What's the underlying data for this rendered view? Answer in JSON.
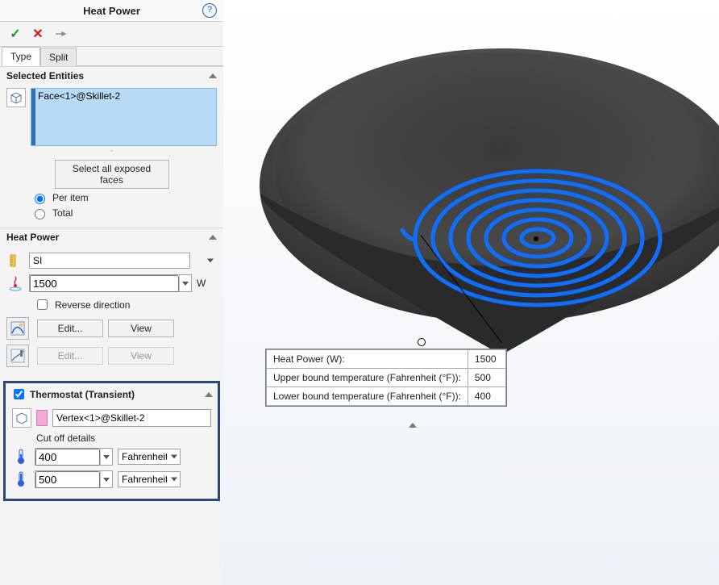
{
  "panel": {
    "title": "Heat Power",
    "help_tooltip": "?"
  },
  "tabs": {
    "type": "Type",
    "split": "Split"
  },
  "selected_entities": {
    "title": "Selected Entities",
    "items": [
      "Face<1>@Skillet-2"
    ],
    "select_all_btn": "Select all exposed faces",
    "per_item_label": "Per item",
    "total_label": "Total",
    "mode": "per_item"
  },
  "heat_power": {
    "title": "Heat Power",
    "unit_system": "SI",
    "value": "1500",
    "value_unit": "W",
    "reverse_label": "Reverse direction",
    "reverse_checked": false,
    "edit_btn": "Edit...",
    "view_btn": "View"
  },
  "thermostat": {
    "title": "Thermostat (Transient)",
    "enabled": true,
    "vertex": "Vertex<1>@Skillet-2",
    "cutoff_label": "Cut off details",
    "lower_value": "400",
    "upper_value": "500",
    "unit": "Fahrenheit"
  },
  "callout": {
    "rows": [
      {
        "label": "Heat Power (W):",
        "value": "1500"
      },
      {
        "label": "Upper bound temperature (Fahrenheit (°F)):",
        "value": "500"
      },
      {
        "label": "Lower bound temperature (Fahrenheit (°F)):",
        "value": "400"
      }
    ]
  },
  "colors": {
    "highlight_border": "#28497a",
    "selection_bg": "#b9dcf6",
    "coil_stroke": "#0e6fff"
  }
}
